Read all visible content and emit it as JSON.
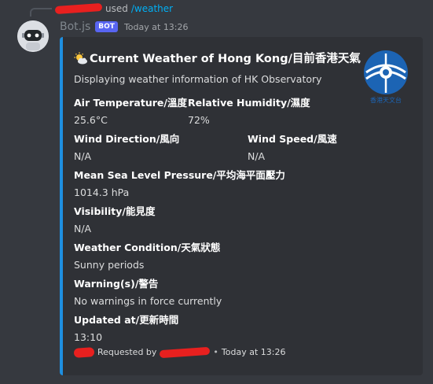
{
  "reply": {
    "used": "used",
    "command": "/weather"
  },
  "header": {
    "bot_name": "Bot.js",
    "bot_tag": "BOT",
    "timestamp": "Today at 13:26"
  },
  "embed": {
    "accent_color": "#1e8fe0",
    "title_icon": "sun-behind-cloud-icon",
    "title": "Current Weather of Hong Kong/目前香港天氣",
    "description": "Displaying weather information of HK Observatory",
    "thumbnail_icon": "hk-observatory-logo",
    "thumbnail_caption": "香港天文台",
    "fields": [
      {
        "name": "Air Temperature/溫度",
        "value": "25.6°C"
      },
      {
        "name": "Relative Humidity/濕度",
        "value": "72%"
      },
      {
        "name": "Wind Direction/風向",
        "value": "N/A"
      },
      {
        "name": "Wind Speed/風速",
        "value": "N/A"
      },
      {
        "name": "Mean Sea Level Pressure/平均海平面壓力",
        "value": "1014.3 hPa"
      },
      {
        "name": "Visibility/能見度",
        "value": "N/A"
      },
      {
        "name": "Weather Condition/天氣狀態",
        "value": "Sunny periods"
      },
      {
        "name": "Warning(s)/警告",
        "value": "No warnings in force currently"
      },
      {
        "name": "Updated at/更新時間",
        "value": "13:10"
      }
    ],
    "footer": {
      "requested_by": "Requested by",
      "separator": "•",
      "timestamp": "Today at 13:26"
    }
  }
}
